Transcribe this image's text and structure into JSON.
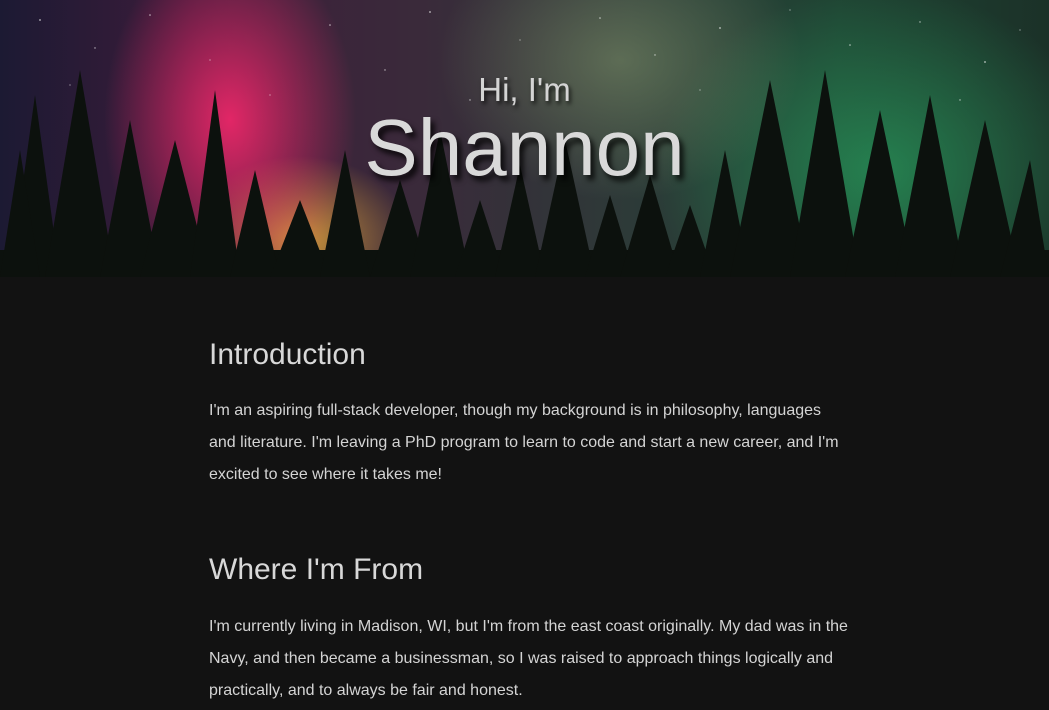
{
  "hero": {
    "greeting": "Hi, I'm",
    "name": "Shannon",
    "background_description_colors": [
      "#ff2a6e",
      "#ffbe3c",
      "#2a9a5a",
      "#1c1a33"
    ]
  },
  "sections": {
    "introduction": {
      "title": "Introduction",
      "text": "I'm an aspiring full-stack developer, though my background is in philosophy, languages and literature. I'm leaving a PhD program to learn to code and start a new career, and I'm excited to see where it takes me!"
    },
    "where_from": {
      "title": "Where I'm From",
      "text": "I'm currently living in Madison, WI, but I'm from the east coast originally. My dad was in the Navy, and then became a businessman, so I was raised to approach things logically and practically, and to always be fair and honest."
    }
  },
  "colors": {
    "page_background": "#121212",
    "text": "#d4d4d4"
  }
}
